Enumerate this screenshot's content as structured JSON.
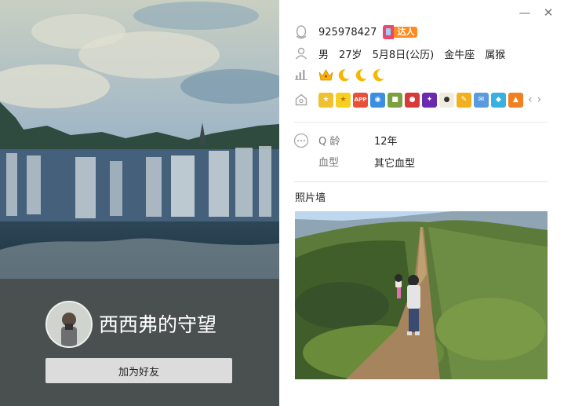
{
  "profile": {
    "nickname": "西西弗的守望",
    "add_friend_label": "加为好友"
  },
  "window": {
    "minimize_glyph": "—",
    "close_glyph": "✕"
  },
  "account": {
    "qq_number": "925978427",
    "badge_label": "达人"
  },
  "personal": {
    "gender": "男",
    "age": "27岁",
    "birthday": "5月8日(公历)",
    "zodiac": "金牛座",
    "chinese_zodiac": "属猴"
  },
  "level": {
    "icons": [
      "crown-icon",
      "moon-icon",
      "moon-icon",
      "moon-icon"
    ]
  },
  "services": {
    "icons": [
      "medal-icon",
      "star-icon",
      "app-icon",
      "camera-icon",
      "gift-icon",
      "pet-icon",
      "game-icon",
      "cow-icon",
      "note-icon",
      "mail-icon",
      "crystal-icon",
      "pilot-icon"
    ],
    "app_text": "APP"
  },
  "details": {
    "q_age_label": "Q 龄",
    "q_age_value": "12年",
    "blood_label": "血型",
    "blood_value": "其它血型"
  },
  "photo_wall": {
    "title": "照片墙"
  },
  "colors": {
    "left_bg": "#4a504f",
    "badge_orange": "#ff8a1d",
    "crown": "#f5b800",
    "moon": "#f5b800"
  }
}
